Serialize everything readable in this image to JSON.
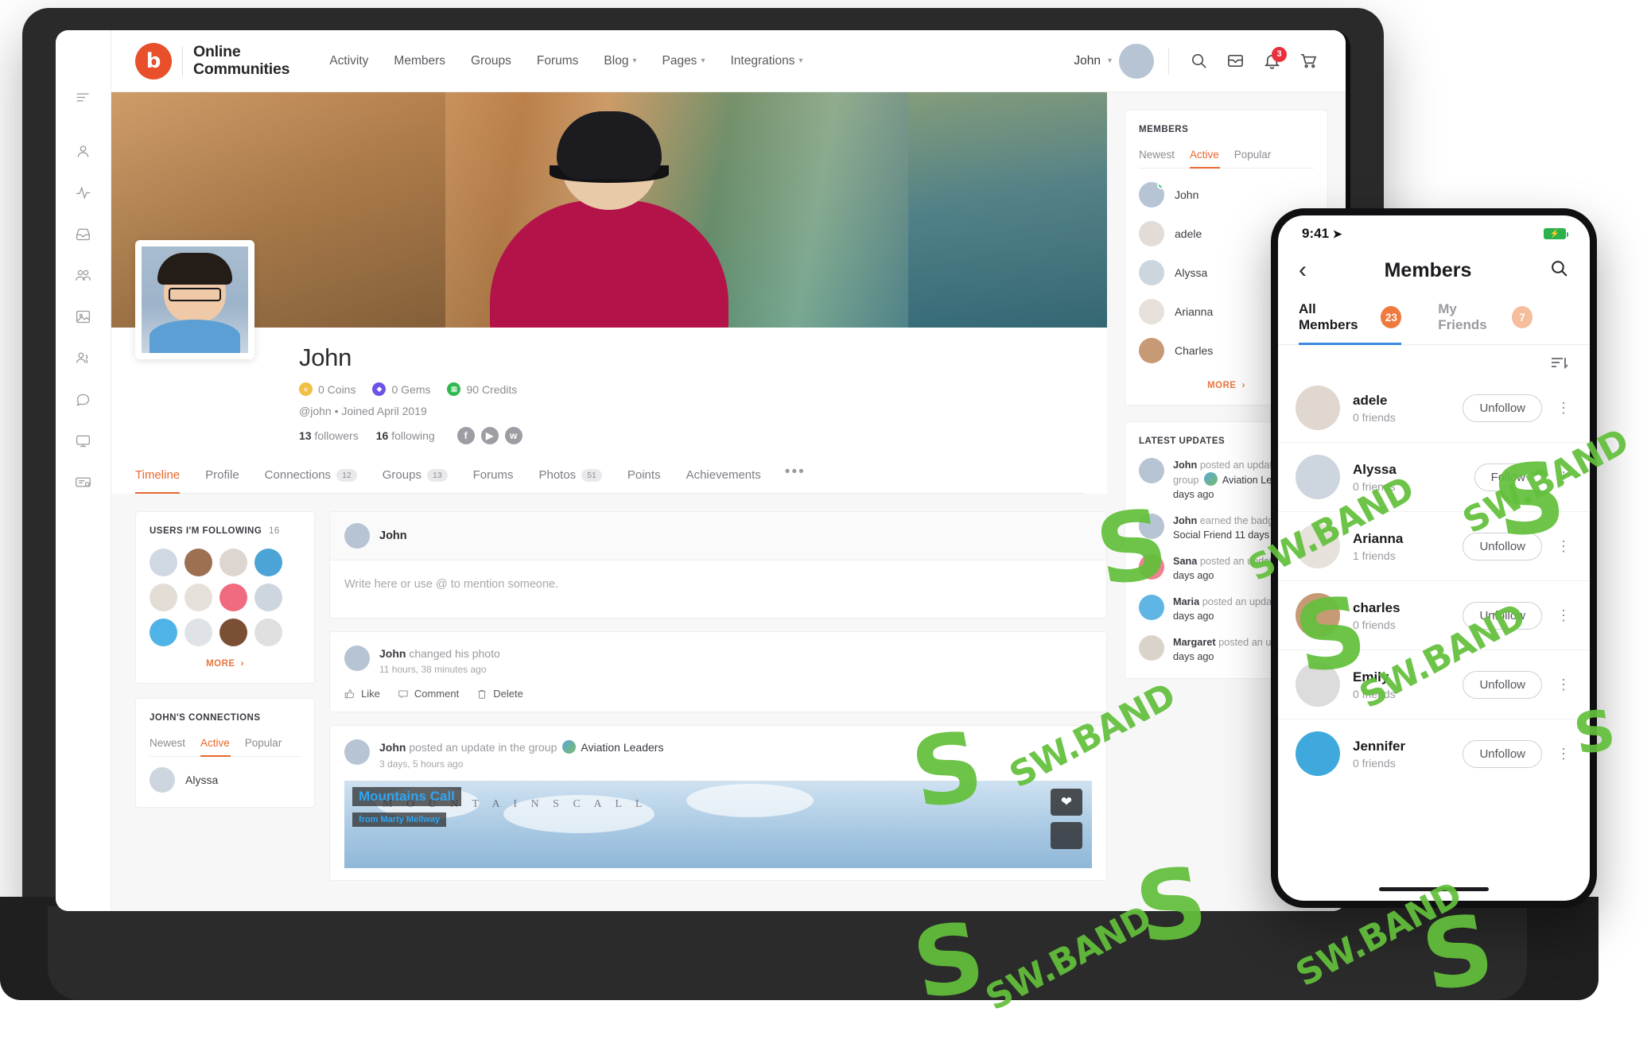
{
  "brand": {
    "name_line1": "Online",
    "name_line2": "Communities",
    "logo_glyph": "b",
    "accent": "#e8502b"
  },
  "nav": [
    {
      "label": "Activity",
      "caret": false
    },
    {
      "label": "Members",
      "caret": false
    },
    {
      "label": "Groups",
      "caret": false
    },
    {
      "label": "Forums",
      "caret": false
    },
    {
      "label": "Blog",
      "caret": true
    },
    {
      "label": "Pages",
      "caret": true
    },
    {
      "label": "Integrations",
      "caret": true
    }
  ],
  "topbar": {
    "user_name": "John",
    "caret": "⌄",
    "icons": [
      "search-icon",
      "inbox-icon",
      "bell-icon",
      "cart-icon"
    ],
    "notification_count": "3"
  },
  "rail": {
    "items": [
      "menu-icon",
      "profile-icon",
      "activity-icon",
      "inbox-icon",
      "groups-icon",
      "photos-icon",
      "friends-icon",
      "messages-icon",
      "screen-icon",
      "certificate-icon"
    ]
  },
  "profile": {
    "name": "John",
    "currencies": [
      {
        "label": "0 Coins",
        "color": "#f0c043",
        "glyph": "¤"
      },
      {
        "label": "0 Gems",
        "color": "#6f52e8",
        "glyph": "◆"
      },
      {
        "label": "90 Credits",
        "color": "#2eb84f",
        "glyph": "▦"
      }
    ],
    "meta": "@john • Joined April 2019",
    "followers_count": "13",
    "followers_label": "followers",
    "following_count": "16",
    "following_label": "following",
    "socials": [
      "facebook-icon",
      "youtube-icon",
      "twitter-icon"
    ]
  },
  "tabs": [
    {
      "label": "Timeline",
      "count": "",
      "active": true
    },
    {
      "label": "Profile",
      "count": "",
      "active": false
    },
    {
      "label": "Connections",
      "count": "12",
      "active": false
    },
    {
      "label": "Groups",
      "count": "13",
      "active": false
    },
    {
      "label": "Forums",
      "count": "",
      "active": false
    },
    {
      "label": "Photos",
      "count": "51",
      "active": false
    },
    {
      "label": "Points",
      "count": "",
      "active": false
    },
    {
      "label": "Achievements",
      "count": "",
      "active": false
    }
  ],
  "tabs_overflow": "•••",
  "following_widget": {
    "title": "USERS I'M FOLLOWING",
    "count": "16",
    "more_label": "MORE",
    "avatars": [
      "#cfd8e3",
      "#9c7050",
      "#ddd6d0",
      "#4ba3d6",
      "#e4ddd6",
      "#e6e0da",
      "#f06a80",
      "#cdd6de",
      "#4fb3e8",
      "#dfe3e7",
      "#7a4f34",
      "#e0e0e0"
    ]
  },
  "connections_widget": {
    "title": "JOHN'S CONNECTIONS",
    "tabs": [
      {
        "label": "Newest",
        "active": false
      },
      {
        "label": "Active",
        "active": true
      },
      {
        "label": "Popular",
        "active": false
      }
    ],
    "members": [
      {
        "name": "Alyssa",
        "color": "#cdd6de"
      }
    ]
  },
  "composer": {
    "author": "John",
    "placeholder": "Write here or use @ to mention someone."
  },
  "posts": [
    {
      "author": "John",
      "action": "changed his photo",
      "time": "11 hours, 38 minutes ago",
      "actions": [
        "Like",
        "Comment",
        "Delete"
      ],
      "has_media": false
    },
    {
      "author": "John",
      "action": "posted an update in the group",
      "group": "Aviation Leaders",
      "time": "3 days, 5 hours ago",
      "has_media": true,
      "media": {
        "title": "Mountains Call",
        "ghost_title": "M O U N T A I N S   C A L L",
        "from_prefix": "from",
        "from_author": "Marty Mellway",
        "like_icon": "heart-icon"
      }
    }
  ],
  "members_widget": {
    "title": "MEMBERS",
    "tabs": [
      {
        "label": "Newest",
        "active": false
      },
      {
        "label": "Active",
        "active": true
      },
      {
        "label": "Popular",
        "active": false
      }
    ],
    "members": [
      {
        "name": "John",
        "color": "#b6c4d4",
        "online": true
      },
      {
        "name": "adele",
        "color": "#e3dcd6",
        "online": false
      },
      {
        "name": "Alyssa",
        "color": "#cdd6de",
        "online": false
      },
      {
        "name": "Arianna",
        "color": "#e6e1db",
        "online": false
      },
      {
        "name": "Charles",
        "color": "#c79a76",
        "online": false
      }
    ],
    "more_label": "MORE"
  },
  "updates_widget": {
    "title": "LATEST UPDATES",
    "items": [
      {
        "author": "John",
        "action": "posted an update in the group",
        "group": "Aviation Leaders",
        "time": "3 days ago",
        "color": "#b6c4d4"
      },
      {
        "author": "John",
        "action": "earned the badges",
        "badge": "Social Friend",
        "time": "11 days ago",
        "color": "#b6c4d4"
      },
      {
        "author": "Sana",
        "action": "posted an update",
        "time": "13 days ago",
        "color": "#f0808f"
      },
      {
        "author": "Maria",
        "action": "posted an update",
        "time": "13 days ago",
        "color": "#5fb6e4"
      },
      {
        "author": "Margaret",
        "action": "posted an update",
        "time": "13 days ago",
        "color": "#d9d3cc"
      }
    ]
  },
  "phone": {
    "status_time": "9:41",
    "location_icon": "location-arrow-icon",
    "battery_icon": "battery-charging-icon",
    "back_icon": "chevron-left-icon",
    "title": "Members",
    "search_icon": "search-icon",
    "tabs": [
      {
        "label": "All Members",
        "count": "23",
        "active": true
      },
      {
        "label": "My Friends",
        "count": "7",
        "active": false
      }
    ],
    "sort_icon": "sort-icon",
    "rows": [
      {
        "name": "adele",
        "friends": "0 friends",
        "button": "Unfollow",
        "color": "#dfd7d0"
      },
      {
        "name": "Alyssa",
        "friends": "0 friends",
        "button": "Follow",
        "color": "#cdd6de"
      },
      {
        "name": "Arianna",
        "friends": "1 friends",
        "button": "Unfollow",
        "color": "#e6e1db"
      },
      {
        "name": "charles",
        "friends": "0 friends",
        "button": "Unfollow",
        "color": "#c79a76"
      },
      {
        "name": "Emily",
        "friends": "0 friends",
        "button": "Unfollow",
        "color": "#dcdcdc"
      },
      {
        "name": "Jennifer",
        "friends": "0 friends",
        "button": "Unfollow",
        "color": "#3fa9dd"
      }
    ],
    "more_icon": "more-vertical-icon"
  },
  "watermark": {
    "text": "SW.BAND",
    "letter": "S",
    "color": "#63c03c"
  }
}
